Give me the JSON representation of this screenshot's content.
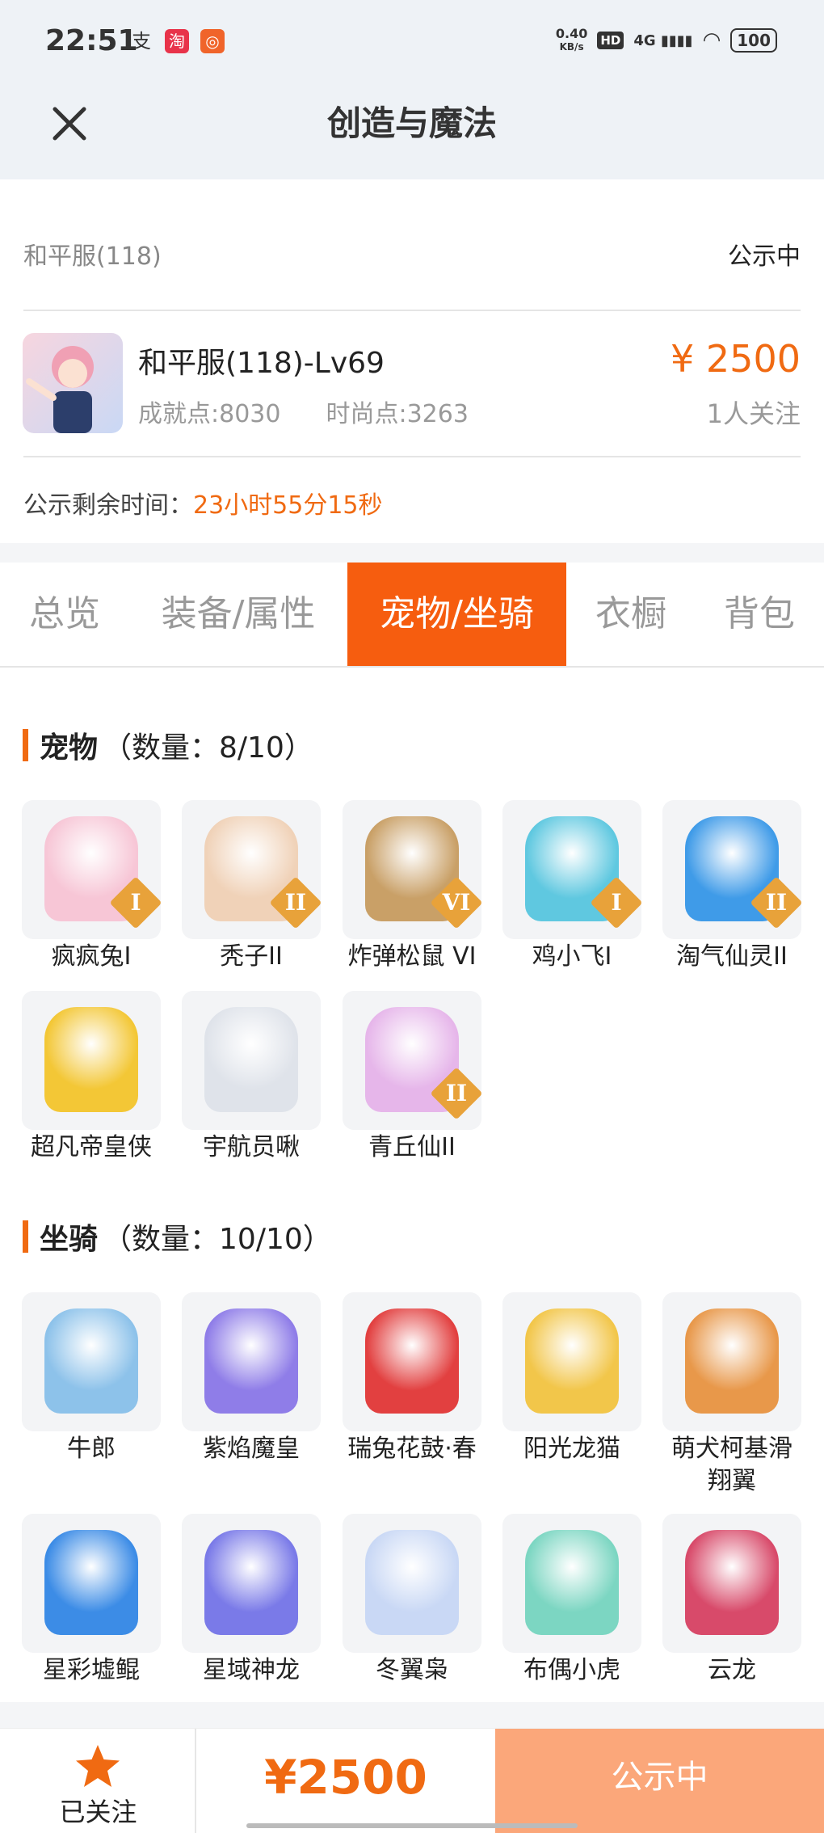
{
  "status_bar": {
    "time": "22:51",
    "net_speed_top": "0.40",
    "net_speed_unit": "KB/s",
    "hd": "HD",
    "signal": "4G",
    "battery": "100"
  },
  "header": {
    "title": "创造与魔法"
  },
  "listing": {
    "server": "和平服(118)",
    "status": "公示中",
    "role_name": "和平服(118)-Lv69",
    "achievement": "成就点:8030",
    "fashion": "时尚点:3263",
    "price": "¥ 2500",
    "followers": "1人关注",
    "remaining_label": "公示剩余时间：",
    "remaining_value": "23小时55分15秒"
  },
  "tabs": [
    {
      "label": "总览"
    },
    {
      "label": "装备/属性"
    },
    {
      "label": "宠物/坐骑",
      "active": true
    },
    {
      "label": "衣橱"
    },
    {
      "label": "背包"
    }
  ],
  "pets": {
    "title": "宠物",
    "count": "（数量：8/10）",
    "items": [
      {
        "name": "疯疯兔I",
        "grade": "I",
        "color": "#f7c6d6"
      },
      {
        "name": "秃子II",
        "grade": "II",
        "color": "#f0d2b8"
      },
      {
        "name": "炸弹松鼠 VI",
        "grade": "VI",
        "color": "#c9a067"
      },
      {
        "name": "鸡小飞I",
        "grade": "I",
        "color": "#5fc8e0"
      },
      {
        "name": "淘气仙灵II",
        "grade": "II",
        "color": "#3f9be8"
      },
      {
        "name": "超凡帝皇侠",
        "grade": "",
        "color": "#f3c736"
      },
      {
        "name": "宇航员啾",
        "grade": "",
        "color": "#dfe3ea"
      },
      {
        "name": "青丘仙II",
        "grade": "II",
        "color": "#e6b6ea"
      }
    ]
  },
  "mounts": {
    "title": "坐骑",
    "count": "（数量：10/10）",
    "items": [
      {
        "name": "牛郎",
        "color": "#8dc2ea"
      },
      {
        "name": "紫焰魔皇",
        "color": "#8f7de8"
      },
      {
        "name": "瑞兔花鼓·春",
        "color": "#e24040"
      },
      {
        "name": "阳光龙猫",
        "color": "#f2c64a"
      },
      {
        "name": "萌犬柯基滑翔翼",
        "color": "#e8984a"
      },
      {
        "name": "星彩墟鲲",
        "color": "#3c8ce6"
      },
      {
        "name": "星域神龙",
        "color": "#7a7ae8"
      },
      {
        "name": "冬翼枭",
        "color": "#c9d8f5"
      },
      {
        "name": "布偶小虎",
        "color": "#7cd6c2"
      },
      {
        "name": "云龙",
        "color": "#d84a6a"
      }
    ]
  },
  "footer": {
    "follow_label": "已关注",
    "price": "¥2500",
    "action": "公示中"
  }
}
